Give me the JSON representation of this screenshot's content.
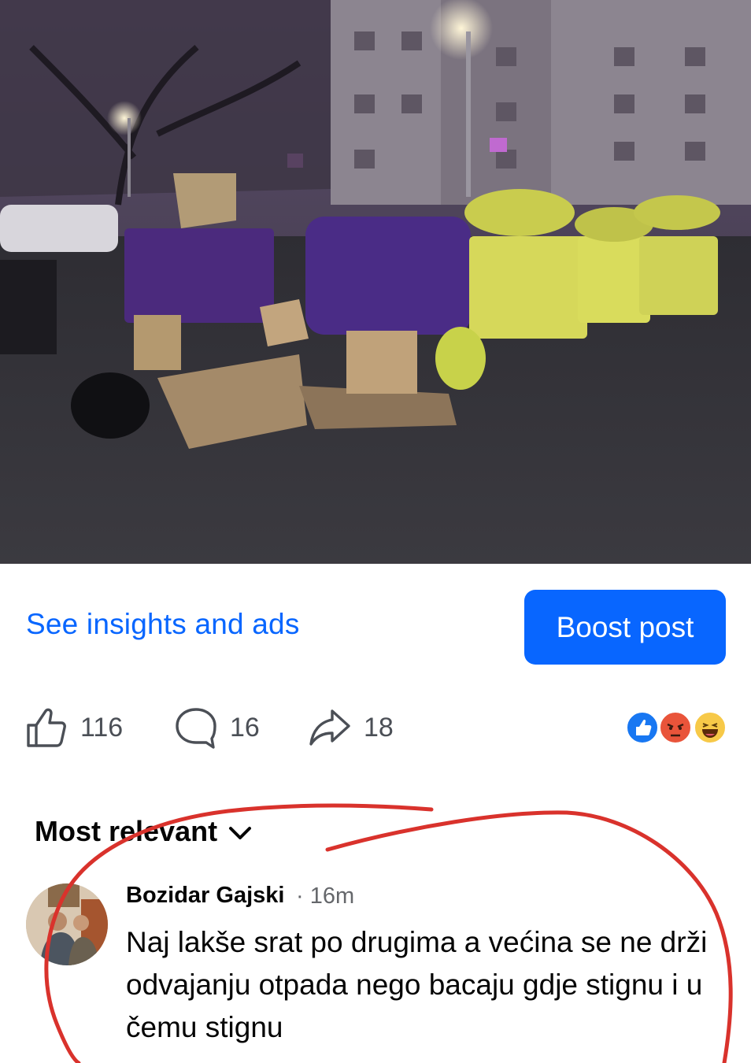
{
  "post": {
    "photo_description": "street scene"
  },
  "actions": {
    "insights_label": "See insights and ads",
    "boost_label": "Boost post"
  },
  "stats": {
    "likes": "116",
    "comments": "16",
    "shares": "18"
  },
  "reactions": [
    "like",
    "angry",
    "haha"
  ],
  "comments_section": {
    "sort_label": "Most relevant",
    "items": [
      {
        "author": "Bozidar Gajski",
        "time": "· 16m",
        "text": "Naj lakše srat po drugima a većina se ne drži odvajanju otpada nego bacaju gdje stignu i u čemu stignu"
      }
    ]
  },
  "colors": {
    "accent": "#0866ff",
    "annotation": "#d9322c"
  }
}
